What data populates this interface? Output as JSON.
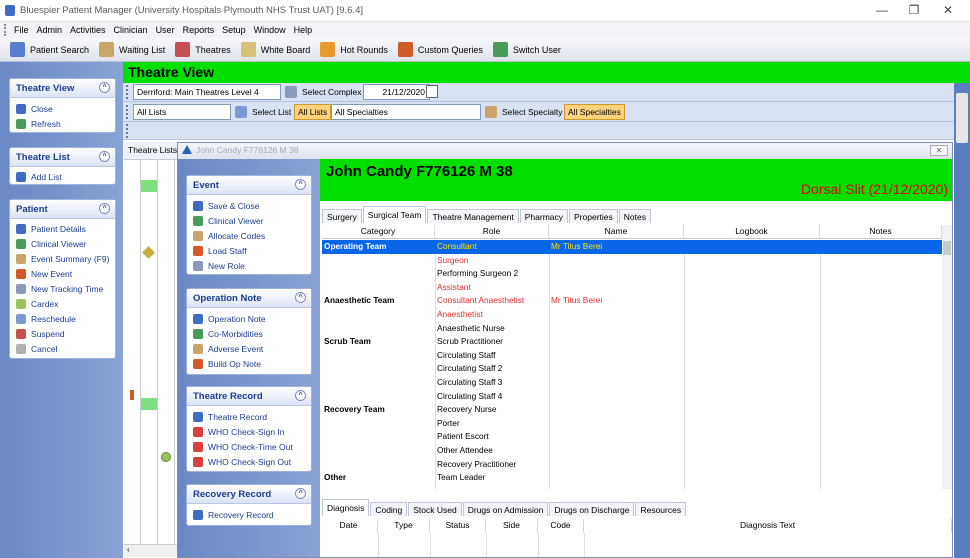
{
  "window": {
    "title": "Bluespier Patient Manager (University Hospitals Plymouth NHS Trust UAT) [9.6.4]"
  },
  "menu": [
    "File",
    "Admin",
    "Activities",
    "Clinician",
    "User",
    "Reports",
    "Setup",
    "Window",
    "Help"
  ],
  "toolbar": [
    {
      "label": "Patient Search",
      "icon": "patient-search-icon",
      "color": "#5b7fcf"
    },
    {
      "label": "Waiting List",
      "icon": "waiting-list-icon",
      "color": "#c8a66a"
    },
    {
      "label": "Theatres",
      "icon": "theatres-icon",
      "color": "#c85050"
    },
    {
      "label": "White Board",
      "icon": "whiteboard-icon",
      "color": "#d8c078"
    },
    {
      "label": "Hot Rounds",
      "icon": "hot-rounds-icon",
      "color": "#e89a2a"
    },
    {
      "label": "Custom Queries",
      "icon": "custom-queries-icon",
      "color": "#d05a28"
    },
    {
      "label": "Switch User",
      "icon": "switch-user-icon",
      "color": "#4a9a5a"
    }
  ],
  "left": {
    "theatre_view": {
      "title": "Theatre View",
      "items": [
        "Close",
        "Refresh"
      ]
    },
    "theatre_list": {
      "title": "Theatre List",
      "items": [
        "Add List"
      ]
    },
    "patient": {
      "title": "Patient",
      "items": [
        "Patient Details",
        "Clinical Viewer",
        "Event Summary (F9)",
        "New Event",
        "New Tracking Time",
        "Cardex",
        "Reschedule",
        "Suspend",
        "Cancel"
      ]
    }
  },
  "theatre_view": {
    "title": "Theatre View",
    "complex_value": "Derriford: Main Theatres Level 4",
    "select_complex": "Select Complex",
    "date_value": "21/12/2020",
    "lists_value": "All Lists",
    "select_list": "Select List",
    "all_lists_badge": "All Lists",
    "specialties_value": "All Specialties",
    "select_specialty": "Select Specialty",
    "all_specialties_badge": "All Specialties",
    "theatre_lists_tab": "Theatre Lists"
  },
  "modal": {
    "title": "John Candy F776126 M 38",
    "patient_header": "John Candy F776126 M 38",
    "procedure": "Dorsal Slit (21/12/2020)",
    "side": {
      "event": {
        "title": "Event",
        "items": [
          "Save & Close",
          "Clinical Viewer",
          "Allocate Codes",
          "Load Staff",
          "New Role"
        ]
      },
      "operation_note": {
        "title": "Operation Note",
        "items": [
          "Operation Note",
          "Co-Morbidities",
          "Adverse Event",
          "Build Op Note"
        ]
      },
      "theatre_record": {
        "title": "Theatre Record",
        "items": [
          "Theatre Record",
          "WHO Check-Sign In",
          "WHO Check-Time Out",
          "WHO Check-Sign Out"
        ]
      },
      "recovery_record": {
        "title": "Recovery Record",
        "items": [
          "Recovery Record"
        ]
      }
    },
    "tabs": [
      "Surgery",
      "Surgical Team",
      "Theatre Management",
      "Pharmacy",
      "Properties",
      "Notes"
    ],
    "active_tab": "Surgical Team",
    "team_columns": [
      "Category",
      "Role",
      "Name",
      "Logbook",
      "Notes"
    ],
    "team_rows": [
      {
        "category": "Operating Team",
        "role": "Consultant",
        "name": "Mr Titus Berei",
        "selected": true
      },
      {
        "category": "",
        "role": "Surgeon",
        "name": "",
        "red": true
      },
      {
        "category": "",
        "role": "Performing Surgeon 2",
        "name": ""
      },
      {
        "category": "",
        "role": "Assistant",
        "name": "",
        "red": true
      },
      {
        "category": "Anaesthetic Team",
        "role": "Consultant Anaesthetist",
        "name": "Mr Titus Berei",
        "red": true
      },
      {
        "category": "",
        "role": "Anaesthetist",
        "name": "",
        "red": true
      },
      {
        "category": "",
        "role": "Anaesthetic Nurse",
        "name": ""
      },
      {
        "category": "Scrub Team",
        "role": "Scrub Practitioner",
        "name": ""
      },
      {
        "category": "",
        "role": "Circulating Staff",
        "name": ""
      },
      {
        "category": "",
        "role": "Circulating Staff 2",
        "name": ""
      },
      {
        "category": "",
        "role": "Circulating Staff 3",
        "name": ""
      },
      {
        "category": "",
        "role": "Circulating Staff 4",
        "name": ""
      },
      {
        "category": "Recovery Team",
        "role": "Recovery Nurse",
        "name": ""
      },
      {
        "category": "",
        "role": "Porter",
        "name": ""
      },
      {
        "category": "",
        "role": "Patient Escort",
        "name": ""
      },
      {
        "category": "",
        "role": "Other Attendee",
        "name": ""
      },
      {
        "category": "",
        "role": "Recovery Practitioner",
        "name": ""
      },
      {
        "category": "Other",
        "role": "Team Leader",
        "name": ""
      }
    ],
    "bottom_tabs": [
      "Diagnosis",
      "Coding",
      "Stock Used",
      "Drugs on Admission",
      "Drugs on Discharge",
      "Resources"
    ],
    "bottom_active_tab": "Diagnosis",
    "diagnosis_columns": [
      "Date",
      "Type",
      "Status",
      "Side",
      "Code",
      "Diagnosis Text"
    ]
  },
  "colors": {
    "accent_green": "#00e000",
    "selected": "#0a66e8",
    "red_text": "#e03030",
    "badge": "#ffd27f"
  }
}
